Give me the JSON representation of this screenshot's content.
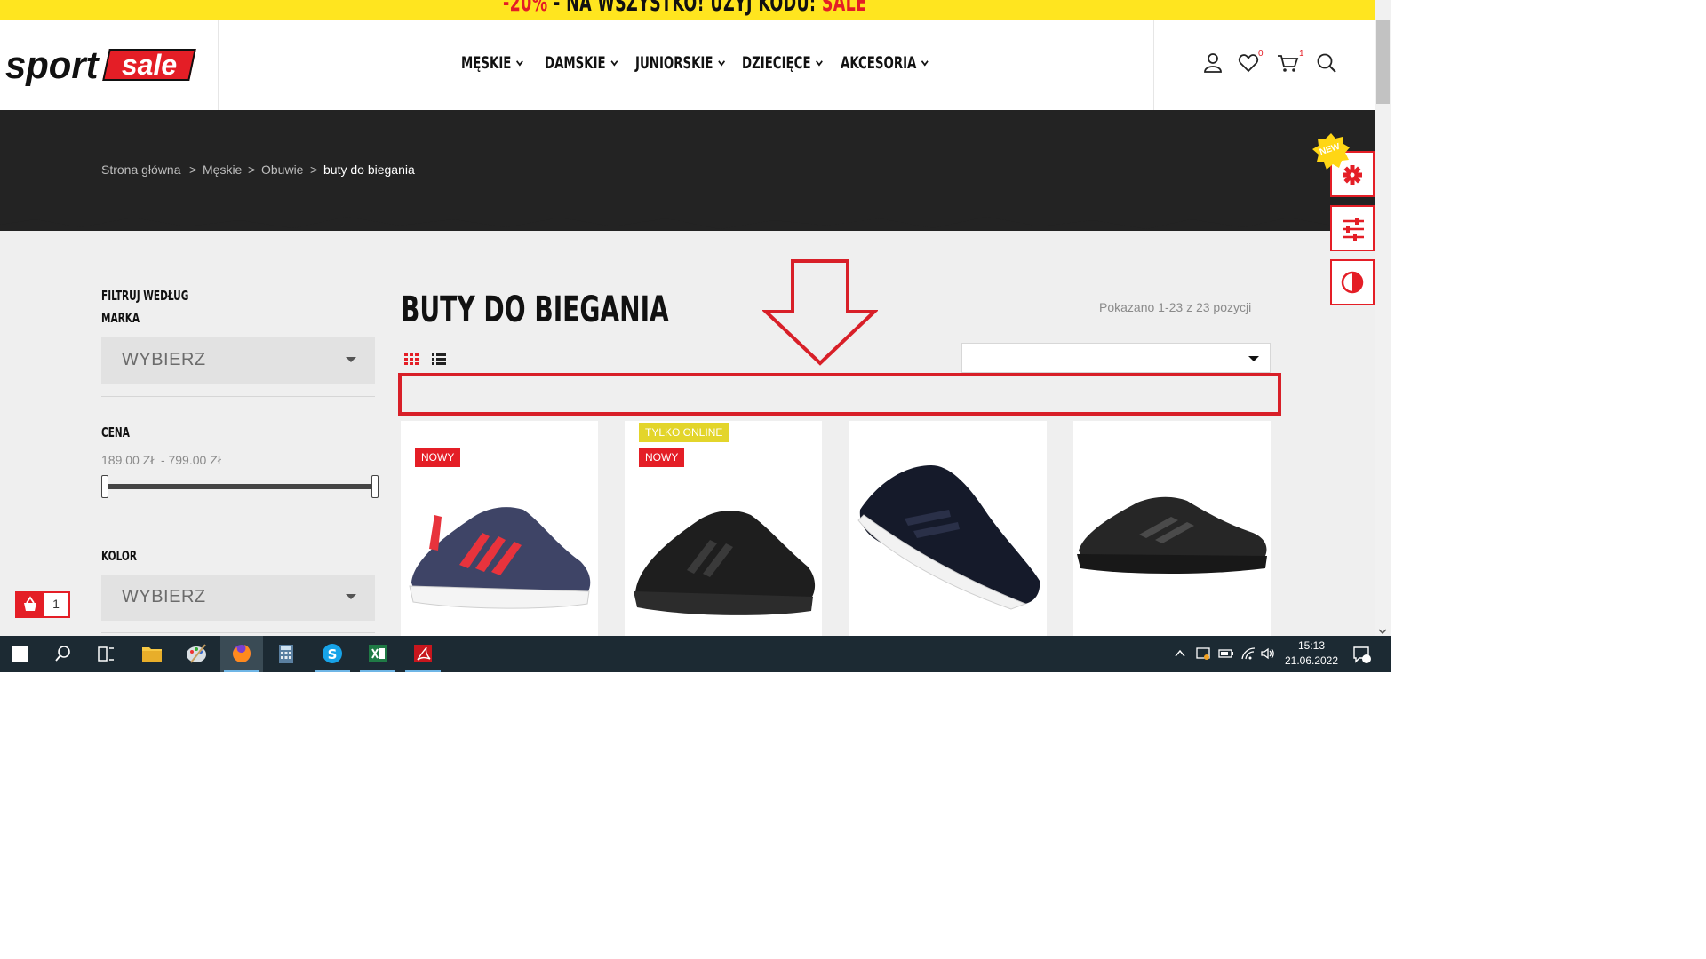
{
  "promo": {
    "discount": "-20%",
    "text": " - NA WSZYSTKO! UŻYJ KODU: ",
    "code": "SALE"
  },
  "logo": {
    "part1": "sport",
    "part2": "sale"
  },
  "nav": [
    {
      "label": "MĘSKIE"
    },
    {
      "label": "DAMSKIE"
    },
    {
      "label": "JUNIORSKIE"
    },
    {
      "label": "DZIECIĘCE"
    },
    {
      "label": "AKCESORIA"
    }
  ],
  "header_icons": {
    "wishlist_count": "0",
    "cart_count": "1"
  },
  "breadcrumb": {
    "home": "Strona główna",
    "sep": ">",
    "men": "Męskie",
    "shoes": "Obuwie",
    "current": "buty do biegania"
  },
  "filters": {
    "heading": "FILTRUJ WEDŁUG",
    "brand_label": "MARKA",
    "brand_value": "WYBIERZ",
    "price_label": "CENA",
    "price_range": "189.00 ZŁ - 799.00 ZŁ",
    "color_label": "KOLOR",
    "color_value": "WYBIERZ"
  },
  "main": {
    "title": "BUTY DO BIEGANIA",
    "shown": "Pokazano 1-23 z 23 pozycji"
  },
  "products": [
    {
      "badges": [
        "NOWY"
      ]
    },
    {
      "badges": [
        "TYLKO ONLINE",
        "NOWY"
      ]
    },
    {
      "badges": []
    },
    {
      "badges": []
    }
  ],
  "side_tools": {
    "new_badge": "NEW"
  },
  "floating_cart": {
    "count": "1"
  },
  "taskbar": {
    "time": "15:13",
    "date": "21.06.2022"
  },
  "colors": {
    "accent": "#e41e26",
    "promo_bg": "#ffe51f",
    "dark_band": "#232323"
  }
}
